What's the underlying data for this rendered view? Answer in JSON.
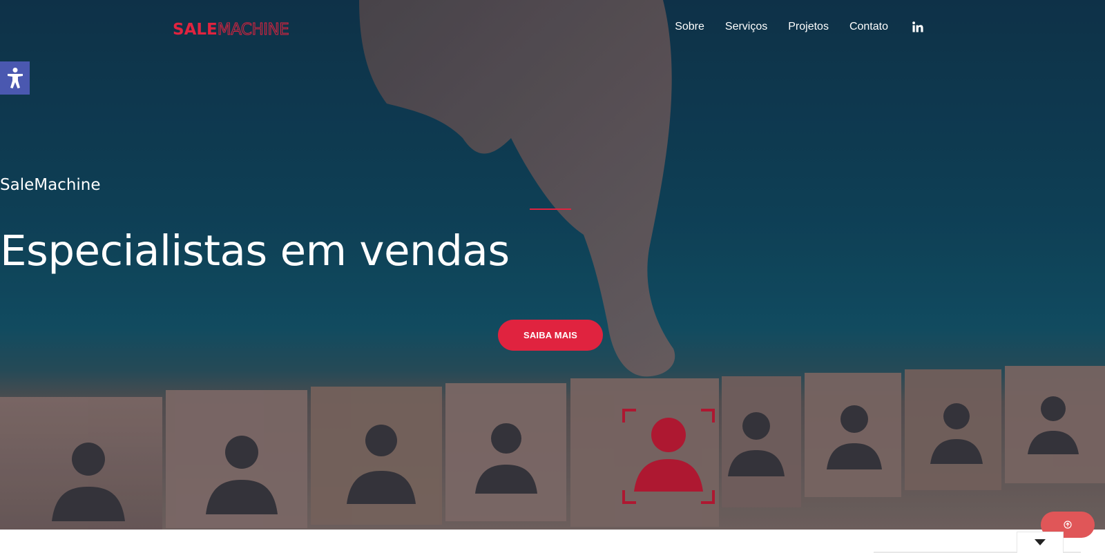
{
  "header": {
    "logo": {
      "part1": "SALE",
      "part2": "MACHINE"
    },
    "nav": [
      {
        "label": "Sobre"
      },
      {
        "label": "Serviços"
      },
      {
        "label": "Projetos"
      },
      {
        "label": "Contato"
      }
    ],
    "social_icon": "linkedin-icon"
  },
  "accessibility": {
    "icon": "accessibility-icon"
  },
  "hero": {
    "eyebrow": "SaleMachine",
    "headline": "Especialistas em vendas",
    "cta_label": "SAIBA MAIS"
  },
  "floating": {
    "scroll_top_icon": "arrow-up-circle-icon",
    "dropdown_icon": "caret-down-icon"
  },
  "colors": {
    "brand_red": "#e0233f",
    "accessibility_blue": "#4a58b0",
    "hero_teal": "#0f4258"
  }
}
